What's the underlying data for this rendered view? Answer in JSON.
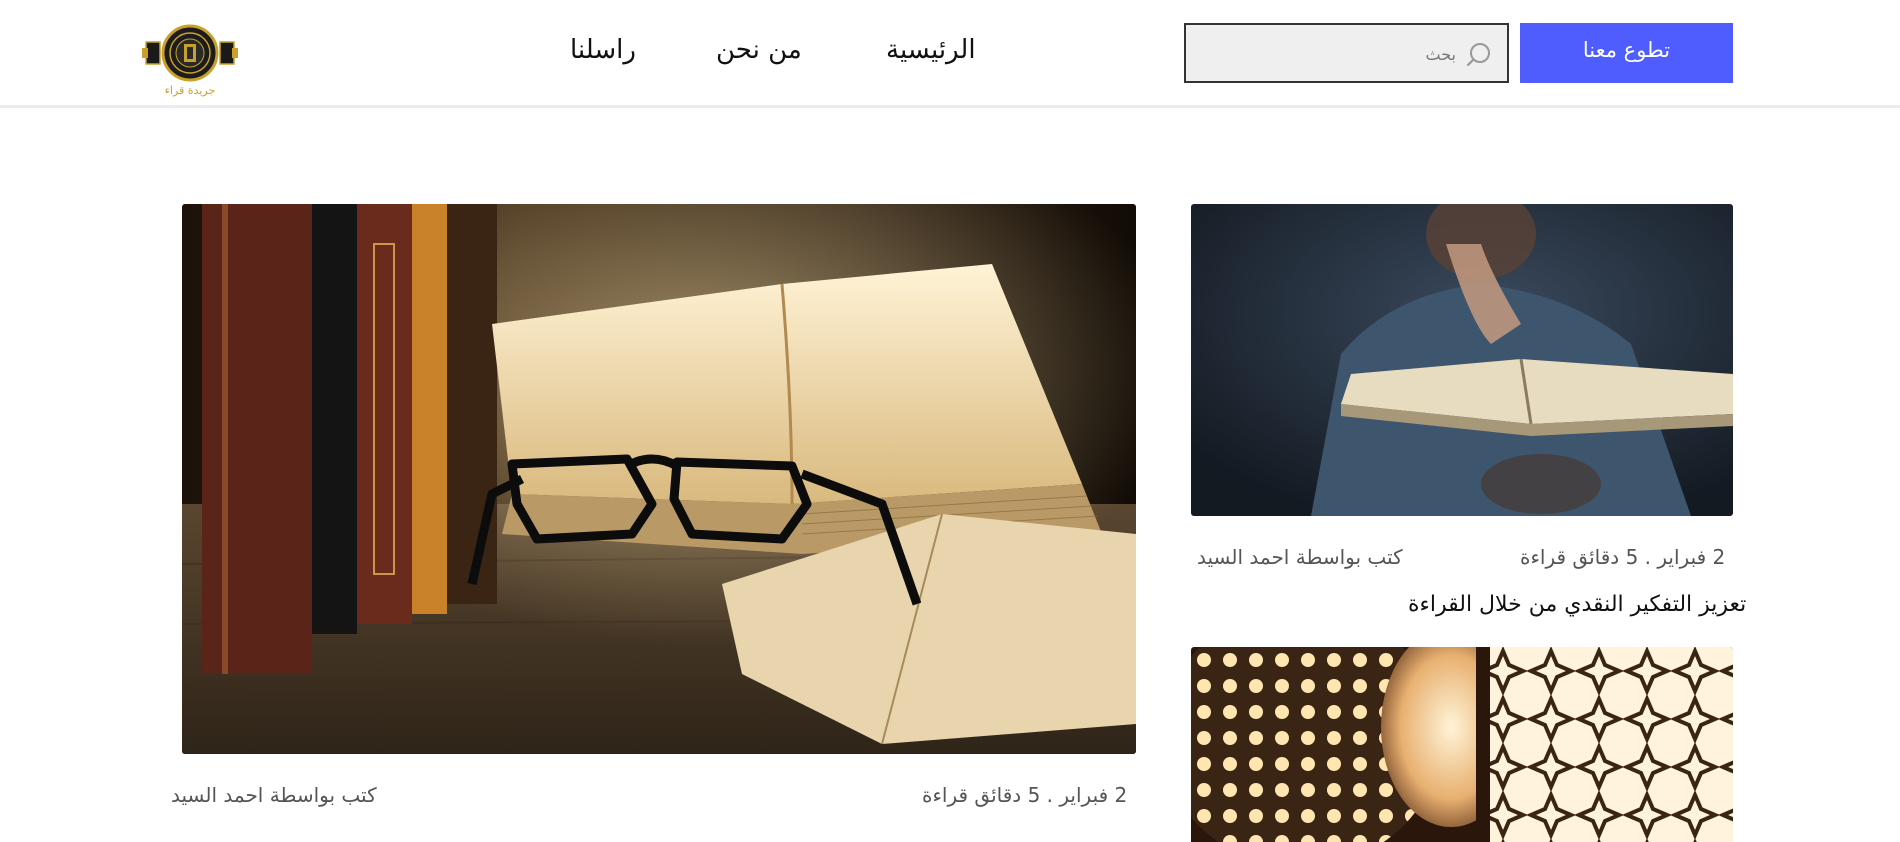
{
  "header": {
    "volunteer_label": "تطوع معنا",
    "search_placeholder": "بحث",
    "nav": {
      "home": "الرئيسية",
      "about": "من نحن",
      "contact": "راسلنا"
    },
    "logo_text": "جريدة قراء",
    "search_icon": "search-icon"
  },
  "featured": {
    "date_readtime": "2 فبراير . 5 دقائق قراءة",
    "author": "كتب بواسطة احمد السيد",
    "image": "book-glasses-image"
  },
  "side_articles": [
    {
      "date_readtime": "2 فبراير . 5 دقائق قراءة",
      "author": "كتب بواسطة احمد السيد",
      "title": "تعزيز التفكير النقدي من خلال القراءة",
      "image": "man-reading-book-image"
    },
    {
      "image": "lantern-image"
    }
  ],
  "colors": {
    "accent": "#4f5dff",
    "logo_gold": "#c9a12a"
  }
}
